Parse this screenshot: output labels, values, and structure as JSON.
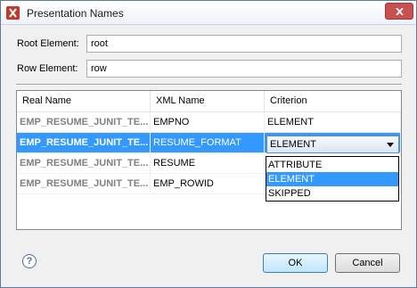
{
  "window": {
    "title": "Presentation Names"
  },
  "form": {
    "root_label": "Root Element:",
    "root_value": "root",
    "row_label": "Row Element:",
    "row_value": "row"
  },
  "table": {
    "columns": [
      "Real Name",
      "XML Name",
      "Criterion"
    ],
    "rows": [
      {
        "real": "EMP_RESUME_JUNIT_TE...",
        "xml": "EMPNO",
        "criterion": "ELEMENT"
      },
      {
        "real": "EMP_RESUME_JUNIT_TE...",
        "xml": "RESUME_FORMAT",
        "criterion": "ELEMENT"
      },
      {
        "real": "EMP_RESUME_JUNIT_TE...",
        "xml": "RESUME",
        "criterion": ""
      },
      {
        "real": "EMP_RESUME_JUNIT_TE...",
        "xml": "EMP_ROWID",
        "criterion": ""
      }
    ]
  },
  "criterion_dropdown": {
    "current": "ELEMENT",
    "options": [
      "ATTRIBUTE",
      "ELEMENT",
      "SKIPPED"
    ],
    "selected": "ELEMENT"
  },
  "buttons": {
    "ok": "OK",
    "cancel": "Cancel",
    "help": "?"
  },
  "colors": {
    "selection": "#3399ff",
    "close": "#c75050"
  }
}
